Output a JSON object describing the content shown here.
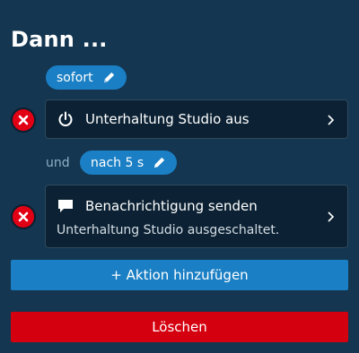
{
  "header": {
    "title": "Dann ..."
  },
  "delays": [
    {
      "label": "sofort"
    },
    {
      "connector": "und",
      "label": "nach 5 s"
    }
  ],
  "actions": [
    {
      "label": "Unterhaltung Studio aus",
      "icon": "power-icon"
    },
    {
      "label": "Benachrichtigung senden",
      "icon": "message-icon",
      "detail": "Unterhaltung Studio ausgeschaltet."
    }
  ],
  "buttons": {
    "add_action": "+ Aktion hinzufügen",
    "delete": "Löschen"
  },
  "colors": {
    "background": "#143650",
    "card": "#0c2234",
    "accent": "#1a7fc4",
    "danger": "#d5000f"
  }
}
